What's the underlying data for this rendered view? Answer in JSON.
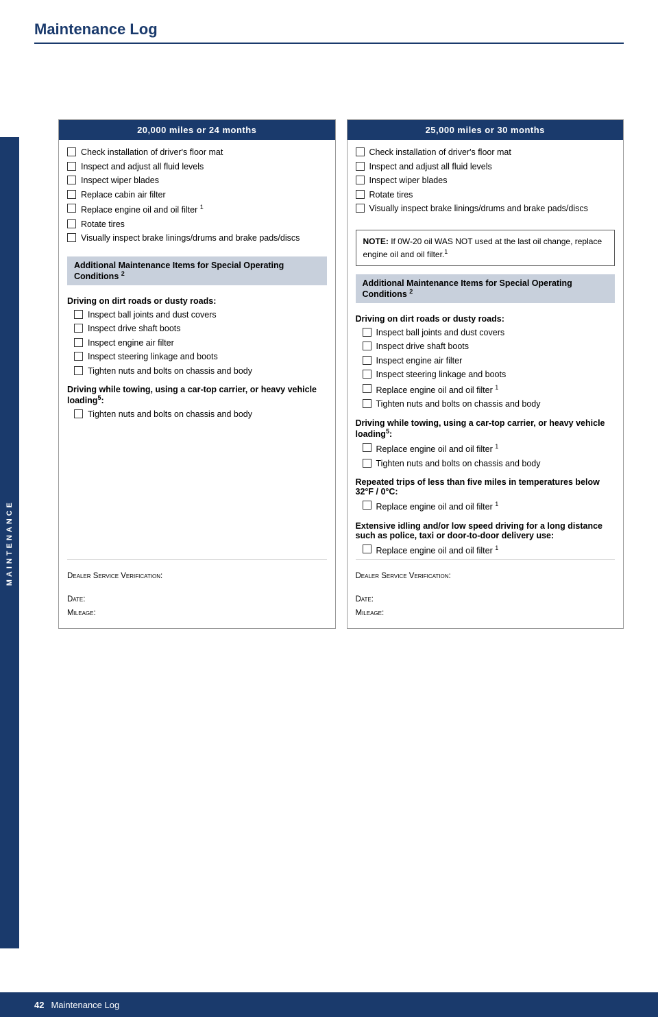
{
  "page": {
    "title": "Maintenance Log",
    "footer_page": "42",
    "footer_label": "Maintenance Log",
    "sidebar_label": "MAINTENANCE"
  },
  "left_column": {
    "header": "20,000 miles or 24 months",
    "main_items": [
      "Check installation of driver's floor mat",
      "Inspect and adjust all fluid levels",
      "Inspect wiper blades",
      "Replace cabin air filter",
      "Replace engine oil and oil filter",
      "Rotate tires",
      "Visually inspect brake linings/drums and brake pads/discs"
    ],
    "main_items_sup": [
      "",
      "",
      "",
      "",
      "1",
      "",
      ""
    ],
    "special_section_header": "Additional Maintenance Items for Special Operating Conditions",
    "special_section_sup": "2",
    "dirt_roads_heading": "Driving on dirt roads or dusty roads:",
    "dirt_roads_items": [
      "Inspect ball joints and dust covers",
      "Inspect drive shaft boots",
      "Inspect engine air filter",
      "Inspect steering linkage and boots",
      "Tighten nuts and bolts on chassis and body"
    ],
    "towing_heading": "Driving while towing, using a car-top carrier, or heavy vehicle loading",
    "towing_heading_sup": "5",
    "towing_items": [
      "Tighten nuts and bolts on chassis and body"
    ],
    "dealer_verification_label": "Dealer Service Verification:",
    "date_label": "Date:",
    "mileage_label": "Mileage:"
  },
  "right_column": {
    "header": "25,000 miles or 30 months",
    "main_items": [
      "Check installation of driver's floor mat",
      "Inspect and adjust all fluid levels",
      "Inspect wiper blades",
      "Rotate tires",
      "Visually inspect brake linings/drums and brake pads/discs"
    ],
    "note_label": "NOTE:",
    "note_text": "If 0W-20 oil WAS NOT used at the last oil change, replace engine oil and oil filter.",
    "note_sup": "1",
    "special_section_header": "Additional Maintenance Items for Special Operating Conditions",
    "special_section_sup": "2",
    "dirt_roads_heading": "Driving on dirt roads or dusty roads:",
    "dirt_roads_items": [
      "Inspect ball joints and dust covers",
      "Inspect drive shaft boots",
      "Inspect engine air filter",
      "Inspect steering linkage and boots",
      "Replace engine oil and oil filter",
      "Tighten nuts and bolts on chassis and body"
    ],
    "dirt_roads_sup": [
      "",
      "",
      "",
      "",
      "1",
      ""
    ],
    "towing_heading": "Driving while towing, using a car-top carrier, or heavy vehicle loading",
    "towing_heading_sup": "5",
    "towing_items": [
      "Replace engine oil and oil filter",
      "Tighten nuts and bolts on chassis and body"
    ],
    "towing_items_sup": [
      "1",
      ""
    ],
    "cold_heading": "Repeated trips of less than five miles in temperatures below 32°F / 0°C:",
    "cold_items": [
      "Replace engine oil and oil filter"
    ],
    "cold_items_sup": [
      "1"
    ],
    "idling_heading": "Extensive idling and/or low speed driving for a long distance such as police, taxi or door-to-door delivery use:",
    "idling_items": [
      "Replace engine oil and oil filter"
    ],
    "idling_items_sup": [
      "1"
    ],
    "dealer_verification_label": "Dealer Service Verification:",
    "date_label": "Date:",
    "mileage_label": "Mileage:"
  }
}
